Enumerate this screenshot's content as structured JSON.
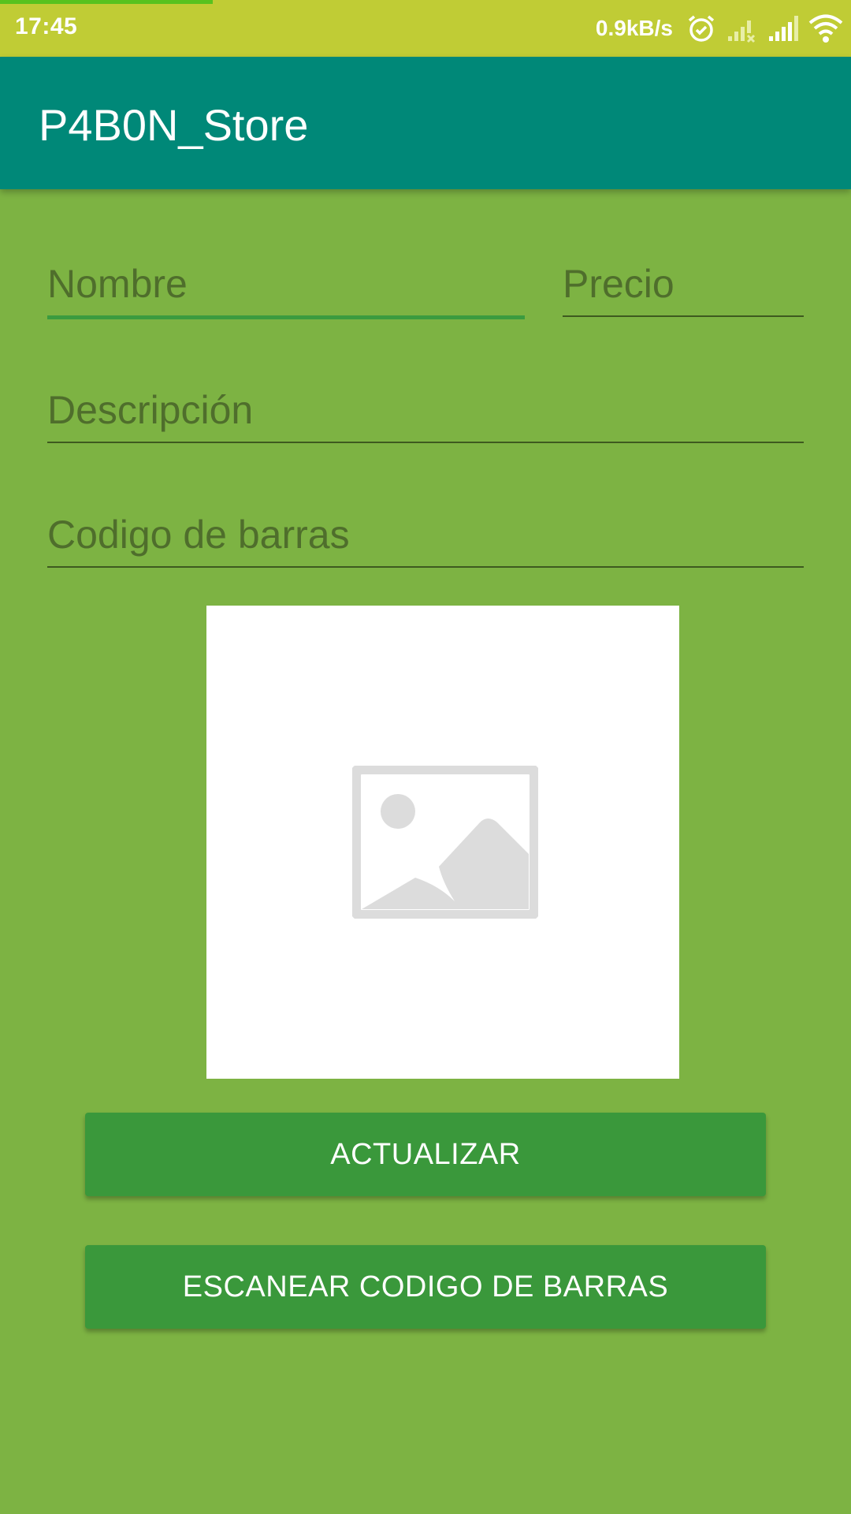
{
  "status_bar": {
    "time": "17:45",
    "network_speed": "0.9kB/s",
    "progress_fraction": 0.25,
    "icons": [
      "alarm-icon",
      "signal-off-icon",
      "signal-icon",
      "wifi-icon"
    ]
  },
  "app_bar": {
    "title": "P4B0N_Store"
  },
  "form": {
    "nombre_placeholder": "Nombre",
    "precio_placeholder": "Precio",
    "descripcion_placeholder": "Descripción",
    "codigo_placeholder": "Codigo de barras"
  },
  "image": {
    "icon": "image-placeholder-icon"
  },
  "buttons": {
    "actualizar": "ACTUALIZAR",
    "escanear": "ESCANEAR CODIGO DE BARRAS"
  },
  "colors": {
    "status_bar": "#c0cc35",
    "app_bar": "#008878",
    "background": "#7db343",
    "button": "#3a983b",
    "focus_underline": "#3b9b3f"
  }
}
